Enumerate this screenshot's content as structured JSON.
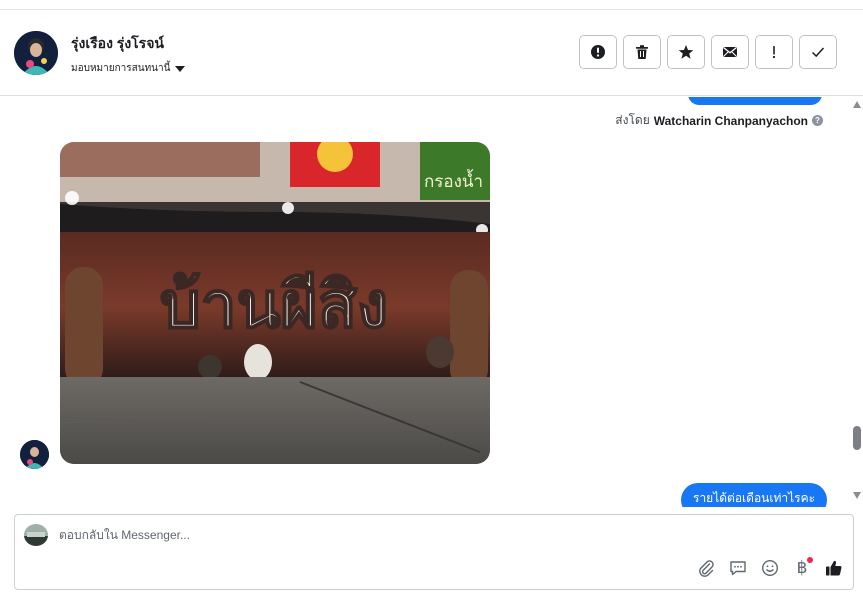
{
  "header": {
    "contact_name": "รุ่งเรือง รุ่งโรจน์",
    "assign_label": "มอบหมายการสนทนานี้",
    "actions": [
      {
        "name": "spam-button",
        "icon": "alert-circle-icon"
      },
      {
        "name": "delete-button",
        "icon": "trash-icon"
      },
      {
        "name": "star-button",
        "icon": "star-icon"
      },
      {
        "name": "mark-unread-button",
        "icon": "envelope-icon"
      },
      {
        "name": "follow-up-button",
        "icon": "exclamation-icon"
      },
      {
        "name": "mark-done-button",
        "icon": "check-icon"
      }
    ]
  },
  "conversation": {
    "sent_by_prefix": "ส่งโดย",
    "sent_by_name": "Watcharin Chanpanyachon",
    "photo_text": "บ้านผีสิง",
    "photo_sign_text": "กรองน้ำ",
    "last_message": "รายได้ต่อเดือนเท่าไรคะ"
  },
  "composer": {
    "placeholder": "ตอบกลับใน Messenger..."
  },
  "colors": {
    "accent": "#1877f2",
    "notification": "#f02849"
  }
}
